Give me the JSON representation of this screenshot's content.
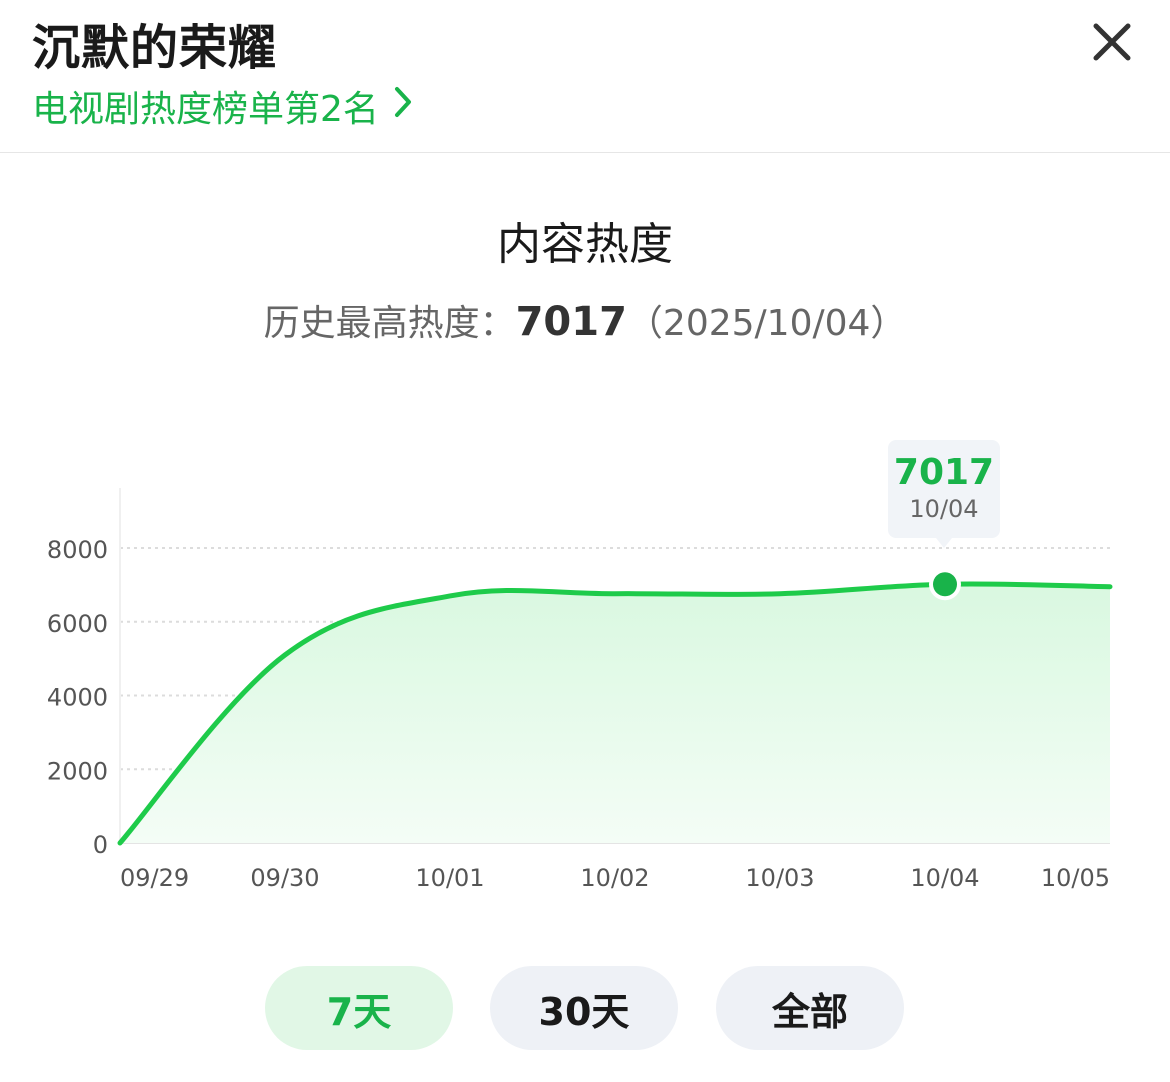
{
  "header": {
    "title": "沉默的荣耀",
    "rank_text": "电视剧热度榜单第2名"
  },
  "section": {
    "title": "内容热度",
    "history_label": "历史最高热度：",
    "history_value": "7017",
    "history_date": "（2025/10/04）"
  },
  "tooltip": {
    "value": "7017",
    "date": "10/04"
  },
  "range_tabs": [
    {
      "label": "7天",
      "active": true
    },
    {
      "label": "30天",
      "active": false
    },
    {
      "label": "全部",
      "active": false
    }
  ],
  "colors": {
    "accent": "#19b34a",
    "line": "#1ecb4a",
    "area": "#e6fbea"
  },
  "chart_data": {
    "type": "area",
    "x": [
      "09/29",
      "09/30",
      "10/01",
      "10/02",
      "10/03",
      "10/04",
      "10/05"
    ],
    "series": [
      {
        "values": [
          0,
          5100,
          6700,
          6760,
          6760,
          7017,
          6950
        ]
      }
    ],
    "ylim": [
      0,
      8000
    ],
    "yticks": [
      0,
      2000,
      4000,
      6000,
      8000
    ],
    "grid": true,
    "highlight": {
      "x": "10/04",
      "value": 7017
    }
  }
}
